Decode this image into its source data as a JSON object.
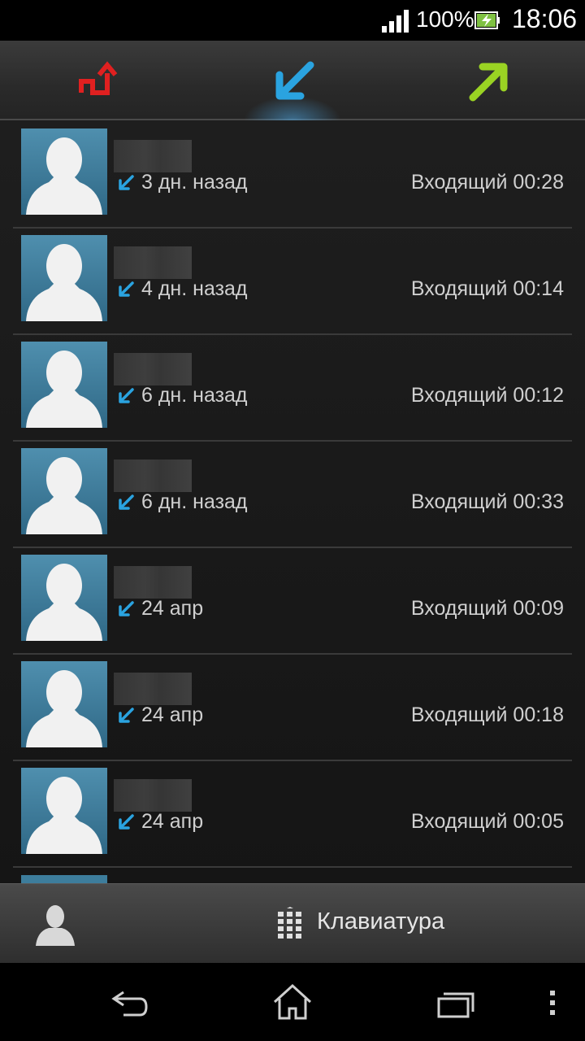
{
  "status_bar": {
    "battery_percent": "100%",
    "time": "18:06"
  },
  "tabs": [
    {
      "name": "missed-calls",
      "icon": "missed-call-arrow-icon",
      "color": "#e02020",
      "active": false
    },
    {
      "name": "incoming-calls",
      "icon": "incoming-call-arrow-icon",
      "color": "#2aa3e0",
      "active": true
    },
    {
      "name": "outgoing-calls",
      "icon": "outgoing-call-arrow-icon",
      "color": "#9ad323",
      "active": false
    }
  ],
  "calls": [
    {
      "when": "3 дн. назад",
      "info": "Входящий 00:28"
    },
    {
      "when": "4 дн. назад",
      "info": "Входящий 00:14"
    },
    {
      "when": "6 дн. назад",
      "info": "Входящий 00:12"
    },
    {
      "when": "6 дн. назад",
      "info": "Входящий 00:33"
    },
    {
      "when": "24 апр",
      "info": "Входящий 00:09"
    },
    {
      "when": "24 апр",
      "info": "Входящий 00:18"
    },
    {
      "when": "24 апр",
      "info": "Входящий 00:05"
    }
  ],
  "action_bar": {
    "keypad_label": "Клавиатура"
  },
  "colors": {
    "incoming": "#2aa3e0",
    "missed": "#e02020",
    "outgoing": "#9ad323"
  }
}
